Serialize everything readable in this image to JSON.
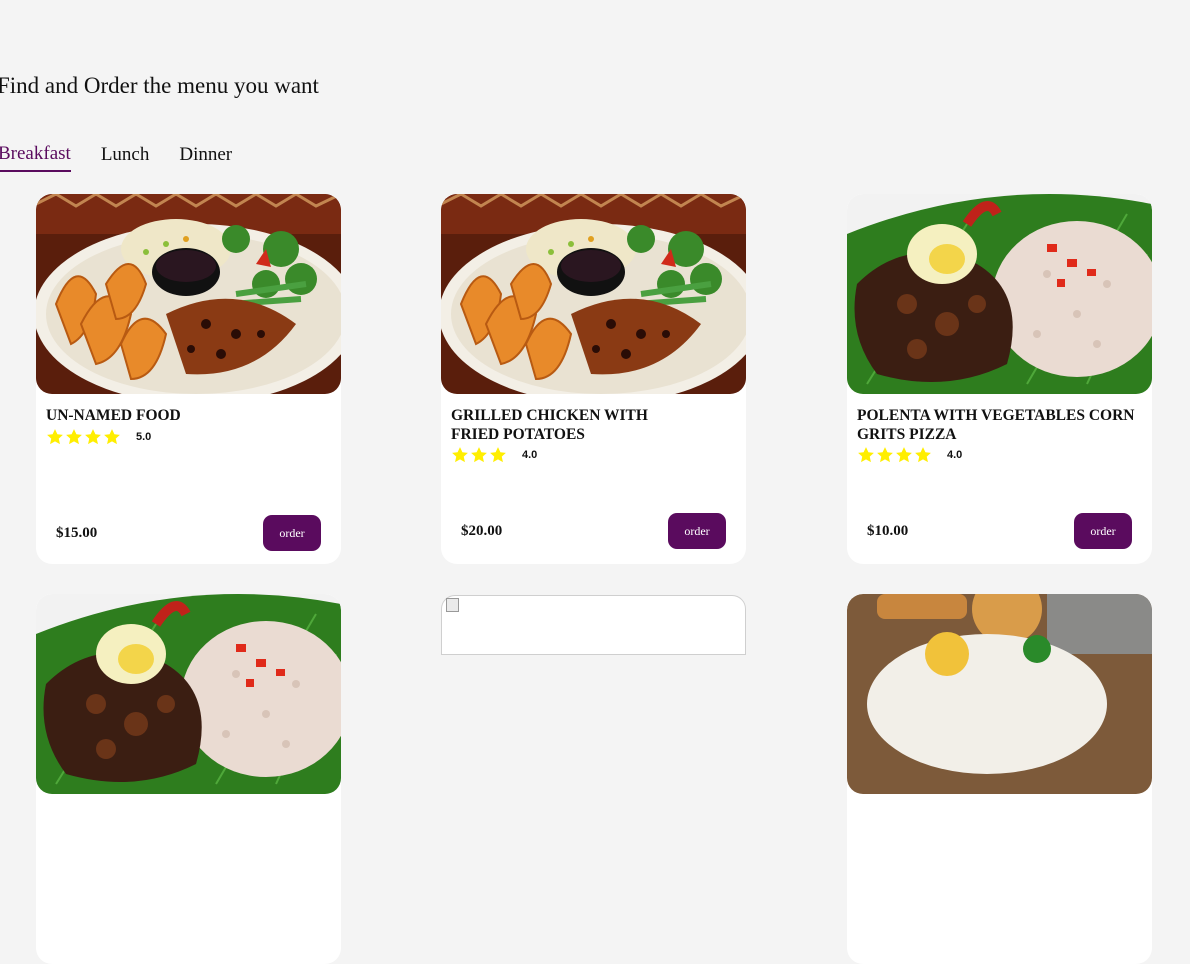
{
  "headline": "Find and Order the menu you want",
  "tabs": [
    {
      "label": "Breakfast",
      "active": true
    },
    {
      "label": "Lunch",
      "active": false
    },
    {
      "label": "Dinner",
      "active": false
    }
  ],
  "order_label": "order",
  "theme": {
    "accent": "#5a0b5e",
    "star": "#ffee00"
  },
  "cards": [
    {
      "name": "UN-NAMED FOOD",
      "rating": "5.0",
      "stars": 4,
      "price": "$15.00",
      "image": "grilled-plate"
    },
    {
      "name": "GRILLED CHICKEN WITH FRIED POTATOES",
      "rating": "4.0",
      "stars": 3,
      "price": "$20.00",
      "image": "grilled-plate"
    },
    {
      "name": "POLENTA WITH VEGETABLES CORN GRITS PIZZA",
      "rating": "4.0",
      "stars": 4,
      "price": "$10.00",
      "image": "rice-stew"
    }
  ],
  "row2_images": [
    "rice-stew",
    "broken-image",
    "toast-plate"
  ]
}
